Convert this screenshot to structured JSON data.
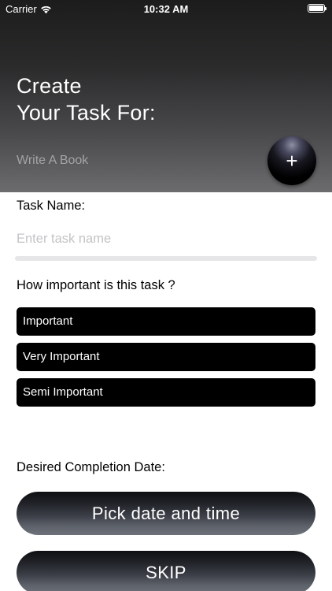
{
  "status_bar": {
    "carrier": "Carrier",
    "time": "10:32 AM"
  },
  "header": {
    "title": "Create\nYour Task For:",
    "subtitle": "Write A Book",
    "add_button_label": "+"
  },
  "form": {
    "task_name_label": "Task Name:",
    "task_name_placeholder": "Enter task name",
    "task_name_value": "",
    "importance_label": "How important is this task ?",
    "importance_options": [
      "Important",
      "Very Important",
      "Semi Important"
    ],
    "date_label": "Desired Completion Date:",
    "pick_date_label": "Pick date and time",
    "skip_label": "SKIP"
  },
  "colors": {
    "option_background": "#000000",
    "header_top": "#1c1c1d",
    "header_bottom": "#6c6c6e",
    "placeholder": "#c4c4c7"
  },
  "icons": {
    "status_wifi": "wifi-icon",
    "status_battery": "battery-icon",
    "add": "plus-icon"
  }
}
